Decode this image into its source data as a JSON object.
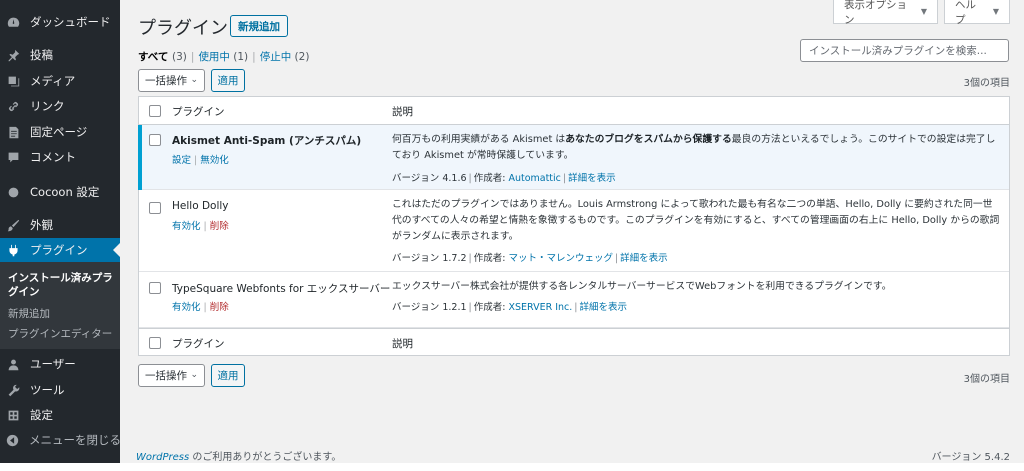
{
  "sidebar": {
    "items": [
      {
        "label": "ダッシュボード",
        "icon": "dashboard-icon"
      },
      {
        "label": "投稿",
        "icon": "pin-icon"
      },
      {
        "label": "メディア",
        "icon": "media-icon"
      },
      {
        "label": "リンク",
        "icon": "link-icon"
      },
      {
        "label": "固定ページ",
        "icon": "page-icon"
      },
      {
        "label": "コメント",
        "icon": "comment-icon"
      },
      {
        "label": "Cocoon 設定",
        "icon": "cocoon-icon"
      },
      {
        "label": "外観",
        "icon": "brush-icon"
      },
      {
        "label": "プラグイン",
        "icon": "plugin-icon"
      },
      {
        "label": "ユーザー",
        "icon": "user-icon"
      },
      {
        "label": "ツール",
        "icon": "wrench-icon"
      },
      {
        "label": "設定",
        "icon": "settings-icon"
      },
      {
        "label": "メニューを閉じる",
        "icon": "collapse-icon"
      }
    ],
    "submenu": {
      "installed_line1": "インストール済みプラ",
      "installed_line2": "グイン",
      "add_new": "新規追加",
      "editor": "プラグインエディター"
    }
  },
  "screen_options": {
    "label": "表示オプション",
    "help": "ヘルプ"
  },
  "header": {
    "title": "プラグイン",
    "add_new": "新規追加"
  },
  "filters": {
    "all": "すべて",
    "all_count": "(3)",
    "active": "使用中",
    "active_count": "(1)",
    "inactive": "停止中",
    "inactive_count": "(2)",
    "separator": "|"
  },
  "search": {
    "placeholder": "インストール済みプラグインを検索..."
  },
  "bulk": {
    "label": "一括操作",
    "apply": "適用",
    "count": "3個の項目"
  },
  "table": {
    "col_plugin": "プラグイン",
    "col_description": "説明",
    "rows": [
      {
        "name": "Akismet Anti-Spam (アンチスパム)",
        "action1": "設定",
        "action2": "無効化",
        "desc_pre": "何百万もの利用実績がある Akismet は",
        "desc_bold": "あなたのブログをスパムから保護する",
        "desc_post": "最良の方法といえるでしょう。このサイトでの設定は完了しており Akismet が常時保護しています。",
        "version": "バージョン 4.1.6",
        "author_label": "作成者:",
        "author": "Automattic",
        "details": "詳細を表示",
        "active": true
      },
      {
        "name": "Hello Dolly",
        "action1": "有効化",
        "action2": "削除",
        "desc": "これはただのプラグインではありません。Louis Armstrong によって歌われた最も有名な二つの単語、Hello, Dolly に要約された同一世代のすべての人々の希望と情熱を象徴するものです。このプラグインを有効にすると、すべての管理画面の右上に Hello, Dolly からの歌詞がランダムに表示されます。",
        "version": "バージョン 1.7.2",
        "author_label": "作成者:",
        "author": "マット・マレンウェッグ",
        "details": "詳細を表示",
        "active": false
      },
      {
        "name": "TypeSquare Webfonts for エックスサーバー",
        "action1": "有効化",
        "action2": "削除",
        "desc": "エックスサーバー株式会社が提供する各レンタルサーバーサービスでWebフォントを利用できるプラグインです。",
        "version": "バージョン 1.2.1",
        "author_label": "作成者:",
        "author": "XSERVER Inc.",
        "details": "詳細を表示",
        "active": false
      }
    ]
  },
  "footer": {
    "wp": "WordPress",
    "thanks": " のご利用ありがとうございます。",
    "version": "バージョン 5.4.2"
  },
  "colors": {
    "sidebar_bg": "#23282d",
    "accent": "#0073aa",
    "active_bar": "#00a0d2",
    "delete": "#b32d2e"
  }
}
